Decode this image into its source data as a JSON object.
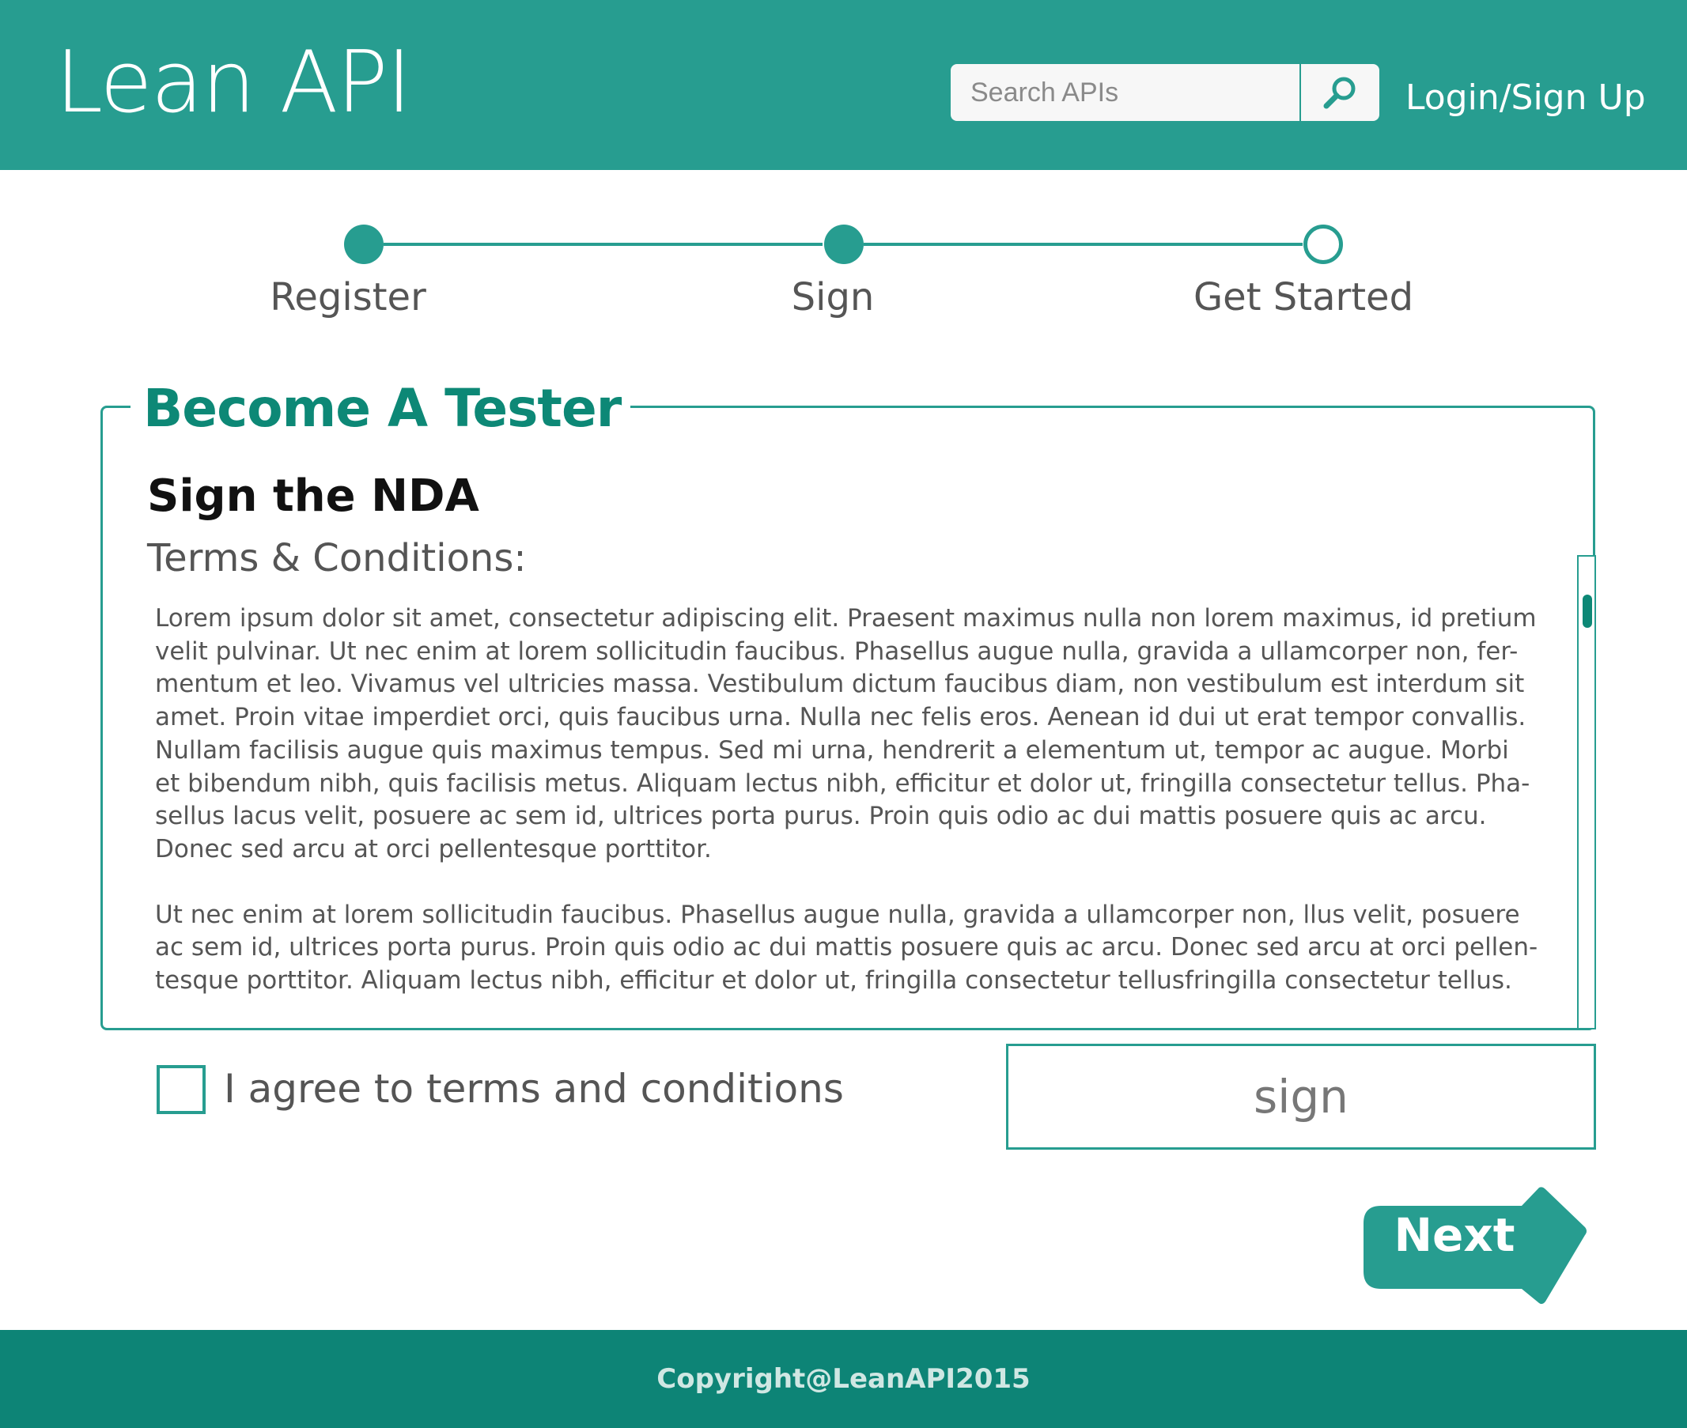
{
  "header": {
    "brand": "Lean API",
    "search": {
      "placeholder": "Search APIs",
      "value": ""
    },
    "search_button_icon": "search-icon",
    "login_label": "Login/Sign Up"
  },
  "stepper": {
    "steps": [
      {
        "label": "Register",
        "state": "complete"
      },
      {
        "label": "Sign",
        "state": "complete"
      },
      {
        "label": "Get Started",
        "state": "pending"
      }
    ]
  },
  "panel": {
    "title": "Become A Tester",
    "heading": "Sign the NDA",
    "subheading": "Terms & Conditions:",
    "paragraphs": [
      "Lorem ipsum dolor sit amet, consectetur adipiscing elit. Praesent maximus nulla non lorem maximus, id pretium velit pulvinar. Ut nec enim at lorem sollicitudin faucibus. Phasellus augue nulla, gravida a ullamcorper non, fer-mentum et leo. Vivamus vel ultricies massa. Vestibulum dictum faucibus diam, non vestibulum est interdum sit amet. Proin vitae imperdiet orci, quis faucibus urna. Nulla nec felis eros. Aenean id dui ut erat tempor convallis. Nullam facilisis augue quis maximus tempus. Sed mi urna, hendrerit a elementum ut, tempor ac augue. Morbi et bibendum nibh, quis facilisis metus. Aliquam lectus nibh, efficitur et dolor ut, fringilla consectetur tellus. Pha-sellus lacus velit, posuere ac sem id, ultrices porta purus. Proin quis odio ac dui mattis posuere quis ac arcu. Donec sed arcu at orci pellentesque porttitor.",
      "Ut nec enim at lorem sollicitudin faucibus. Phasellus augue nulla, gravida a ullamcorper non, llus velit, posuere ac sem id, ultrices porta purus. Proin quis odio ac dui mattis posuere quis ac arcu. Donec sed arcu at orci pellen-tesque porttitor.  Aliquam lectus nibh, efficitur et dolor ut, fringilla consectetur tellusfringilla consectetur tellus."
    ]
  },
  "agreement": {
    "checkbox_label": "I agree to terms and conditions",
    "checked": false
  },
  "sign_field": {
    "placeholder": "sign"
  },
  "next_button": {
    "label": "Next"
  },
  "footer": {
    "copyright": "Copyright@LeanAPI2015"
  },
  "colors": {
    "primary": "#279d90",
    "dark": "#0d8476",
    "text": "#555555"
  }
}
